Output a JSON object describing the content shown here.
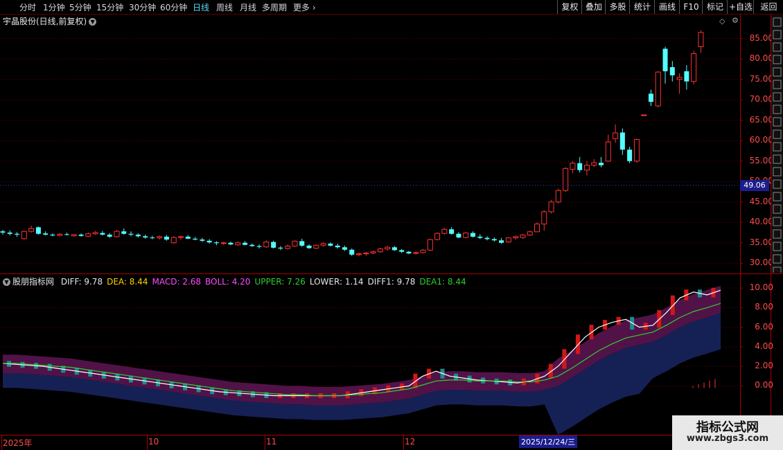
{
  "toolbar": {
    "periods": [
      "分时",
      "1分钟",
      "5分钟",
      "15分钟",
      "30分钟",
      "60分钟",
      "日线",
      "周线",
      "月线",
      "多周期",
      "更多"
    ],
    "active": "日线",
    "right": [
      "复权",
      "叠加",
      "多股",
      "统计",
      "画线",
      "F10",
      "标记",
      "+自选",
      "返回"
    ]
  },
  "stock_title": "宇晶股份(日线,前复权)",
  "price_tag": "49.06",
  "indicator": {
    "name": "股朋指标网",
    "items": [
      {
        "label": "DIFF: 9.78",
        "color": "#e8e8e8"
      },
      {
        "label": "DEA: 8.44",
        "color": "#ffd200"
      },
      {
        "label": "MACD: 2.68",
        "color": "#ff4cff"
      },
      {
        "label": "BOLL: 4.20",
        "color": "#ff4cff"
      },
      {
        "label": "UPPER: 7.26",
        "color": "#30d030"
      },
      {
        "label": "LOWER: 1.14",
        "color": "#e8e8e8"
      },
      {
        "label": "DIFF1: 9.78",
        "color": "#e8e8e8"
      },
      {
        "label": "DEA1: 8.44",
        "color": "#30d030"
      }
    ]
  },
  "x_labels": [
    "2025年",
    "10",
    "11",
    "12"
  ],
  "date_box": "2025/12/24/三",
  "watermark": {
    "line1": "指标公式网",
    "line2": "www.zbgs3.com"
  },
  "chart_data": [
    {
      "type": "candlestick",
      "title": "宇晶股份(日线,前复权)",
      "y_ticks": [
        30,
        35,
        40,
        45,
        50,
        55,
        60,
        65,
        70,
        75,
        80,
        85
      ],
      "ylim": [
        28,
        88
      ],
      "x_ticks": [
        "2025年",
        "10",
        "11",
        "12",
        "2025/12/24/三"
      ],
      "last_price": 49.06,
      "up_color": "#ff3232",
      "down_color": "#54ffff",
      "candles": [
        [
          37.8,
          38.2,
          37.0,
          37.5
        ],
        [
          37.5,
          38.0,
          36.8,
          37.2
        ],
        [
          37.2,
          37.6,
          36.5,
          37.0
        ],
        [
          36.0,
          38.0,
          35.8,
          37.8
        ],
        [
          37.8,
          39.2,
          37.5,
          38.5
        ],
        [
          38.8,
          39.0,
          37.0,
          37.2
        ],
        [
          37.3,
          37.8,
          36.8,
          37.0
        ],
        [
          37.0,
          37.3,
          36.6,
          36.8
        ],
        [
          36.8,
          37.4,
          36.6,
          37.1
        ],
        [
          37.1,
          37.5,
          36.8,
          37.0
        ],
        [
          36.7,
          37.2,
          36.5,
          37.0
        ],
        [
          37.0,
          37.3,
          36.5,
          36.7
        ],
        [
          36.6,
          37.5,
          36.4,
          37.2
        ],
        [
          37.2,
          37.9,
          36.9,
          37.5
        ],
        [
          37.4,
          37.9,
          36.8,
          37.0
        ],
        [
          37.0,
          37.4,
          36.2,
          36.5
        ],
        [
          36.5,
          38.2,
          36.3,
          37.8
        ],
        [
          37.8,
          38.5,
          37.0,
          37.2
        ],
        [
          37.2,
          37.8,
          36.6,
          37.0
        ],
        [
          37.0,
          37.3,
          36.3,
          36.6
        ],
        [
          36.6,
          37.0,
          36.0,
          36.3
        ],
        [
          36.3,
          36.7,
          35.9,
          36.2
        ],
        [
          36.2,
          36.8,
          35.8,
          36.5
        ],
        [
          36.5,
          36.9,
          35.5,
          35.8
        ],
        [
          35.0,
          36.6,
          34.8,
          36.3
        ],
        [
          36.3,
          36.8,
          35.8,
          36.5
        ],
        [
          36.5,
          36.9,
          35.9,
          36.0
        ],
        [
          36.0,
          36.4,
          35.6,
          35.8
        ],
        [
          35.8,
          36.2,
          35.2,
          35.5
        ],
        [
          35.5,
          35.9,
          34.8,
          35.1
        ],
        [
          35.1,
          35.4,
          34.4,
          34.9
        ],
        [
          34.9,
          35.2,
          34.5,
          35.0
        ],
        [
          35.0,
          35.3,
          34.4,
          34.6
        ],
        [
          34.5,
          35.3,
          34.3,
          35.0
        ],
        [
          35.0,
          35.4,
          34.4,
          34.5
        ],
        [
          34.5,
          34.8,
          34.0,
          34.2
        ],
        [
          34.2,
          34.6,
          33.6,
          34.0
        ],
        [
          34.0,
          35.6,
          33.8,
          35.2
        ],
        [
          35.2,
          35.5,
          33.6,
          33.8
        ],
        [
          33.8,
          34.2,
          33.2,
          33.6
        ],
        [
          33.6,
          34.6,
          33.4,
          34.2
        ],
        [
          34.2,
          35.6,
          34.0,
          35.4
        ],
        [
          35.4,
          36.0,
          34.0,
          34.3
        ],
        [
          34.3,
          34.6,
          33.5,
          33.7
        ],
        [
          33.7,
          34.6,
          33.5,
          34.4
        ],
        [
          34.4,
          35.2,
          34.0,
          34.8
        ],
        [
          34.8,
          35.1,
          34.1,
          34.3
        ],
        [
          34.3,
          34.8,
          33.6,
          33.9
        ],
        [
          33.9,
          34.3,
          33.0,
          33.3
        ],
        [
          33.3,
          33.6,
          31.8,
          32.1
        ],
        [
          32.1,
          32.6,
          31.7,
          32.3
        ],
        [
          32.3,
          32.8,
          31.8,
          32.5
        ],
        [
          32.5,
          33.1,
          32.2,
          32.8
        ],
        [
          32.8,
          33.8,
          32.6,
          33.5
        ],
        [
          33.5,
          34.3,
          33.1,
          33.9
        ],
        [
          33.9,
          34.2,
          33.0,
          33.2
        ],
        [
          33.2,
          33.5,
          32.5,
          32.8
        ],
        [
          32.8,
          33.0,
          32.2,
          32.4
        ],
        [
          32.4,
          32.9,
          32.1,
          32.6
        ],
        [
          32.6,
          33.5,
          32.4,
          33.2
        ],
        [
          33.2,
          36.0,
          33.0,
          35.8
        ],
        [
          35.8,
          37.6,
          35.6,
          37.3
        ],
        [
          37.3,
          38.7,
          37.0,
          38.3
        ],
        [
          38.3,
          38.8,
          37.0,
          37.2
        ],
        [
          37.2,
          37.6,
          36.1,
          36.3
        ],
        [
          36.3,
          37.6,
          36.1,
          37.4
        ],
        [
          37.4,
          37.8,
          36.3,
          36.5
        ],
        [
          36.5,
          37.1,
          35.9,
          36.2
        ],
        [
          36.2,
          36.6,
          35.6,
          35.9
        ],
        [
          35.9,
          36.3,
          35.3,
          35.6
        ],
        [
          35.6,
          36.2,
          34.8,
          35.0
        ],
        [
          35.2,
          36.4,
          35.0,
          36.2
        ],
        [
          36.2,
          36.8,
          35.8,
          36.5
        ],
        [
          36.3,
          37.2,
          36.0,
          36.9
        ],
        [
          36.9,
          38.0,
          36.7,
          37.7
        ],
        [
          37.7,
          40.0,
          37.6,
          39.6
        ],
        [
          39.6,
          43.0,
          38.0,
          42.6
        ],
        [
          42.6,
          45.5,
          42.2,
          45.0
        ],
        [
          45.0,
          48.3,
          44.6,
          47.8
        ],
        [
          47.8,
          53.5,
          47.4,
          53.2
        ],
        [
          53.0,
          55.0,
          52.0,
          54.5
        ],
        [
          54.5,
          56.0,
          52.2,
          52.8
        ],
        [
          52.8,
          55.0,
          51.5,
          54.0
        ],
        [
          54.0,
          55.5,
          53.5,
          54.6
        ],
        [
          54.6,
          56.0,
          53.5,
          54.0
        ],
        [
          55.0,
          61.5,
          54.8,
          59.7
        ],
        [
          60.5,
          64.0,
          59.5,
          61.9
        ],
        [
          62.0,
          63.0,
          56.5,
          57.8
        ],
        [
          57.8,
          58.5,
          54.5,
          55.0
        ],
        [
          55.0,
          60.5,
          54.6,
          60.3
        ],
        [
          66.3,
          66.4,
          66.2,
          66.3
        ],
        [
          71.5,
          72.5,
          68.5,
          69.5
        ],
        [
          68.5,
          77.0,
          68.2,
          76.8
        ],
        [
          82.5,
          83.0,
          74.0,
          77.0
        ],
        [
          78.0,
          79.5,
          74.5,
          76.0
        ],
        [
          75.0,
          76.5,
          71.5,
          75.5
        ],
        [
          77.0,
          78.5,
          72.5,
          74.5
        ],
        [
          74.5,
          82.0,
          73.8,
          81.3
        ],
        [
          83.0,
          87.0,
          81.5,
          86.5
        ]
      ]
    },
    {
      "type": "line",
      "title": "股朋指标网",
      "y_ticks": [
        0.0,
        2.0,
        4.0,
        6.0,
        8.0,
        10.0
      ],
      "ylim": [
        -5,
        11
      ],
      "series": [
        {
          "name": "DIFF",
          "color": "#ffffff",
          "values": [
            2.3,
            2.2,
            2.1,
            2.0,
            1.8,
            1.6,
            1.4,
            1.2,
            1.0,
            0.8,
            0.6,
            0.4,
            0.2,
            0.0,
            -0.2,
            -0.4,
            -0.6,
            -0.7,
            -0.8,
            -0.9,
            -1.0,
            -1.0,
            -1.0,
            -1.0,
            -1.0,
            -1.0,
            -0.8,
            -0.6,
            -0.4,
            -0.2,
            0.0,
            1.0,
            1.5,
            1.0,
            0.8,
            0.6,
            0.5,
            0.4,
            0.3,
            0.5,
            1.0,
            2.0,
            3.5,
            5.0,
            6.0,
            6.5,
            6.8,
            6.0,
            6.2,
            7.5,
            9.0,
            9.6,
            9.3,
            9.78
          ]
        },
        {
          "name": "DEA",
          "color": "#30d030",
          "values": [
            2.3,
            2.3,
            2.2,
            2.1,
            2.0,
            1.9,
            1.7,
            1.5,
            1.3,
            1.1,
            0.9,
            0.7,
            0.5,
            0.3,
            0.1,
            -0.1,
            -0.3,
            -0.5,
            -0.6,
            -0.7,
            -0.8,
            -0.9,
            -0.9,
            -1.0,
            -1.0,
            -1.0,
            -0.9,
            -0.8,
            -0.7,
            -0.5,
            -0.3,
            0.1,
            0.5,
            0.6,
            0.6,
            0.5,
            0.5,
            0.5,
            0.4,
            0.4,
            0.6,
            1.0,
            1.8,
            2.7,
            3.6,
            4.3,
            4.9,
            5.2,
            5.5,
            6.2,
            7.0,
            7.6,
            8.0,
            8.44
          ]
        }
      ]
    }
  ]
}
